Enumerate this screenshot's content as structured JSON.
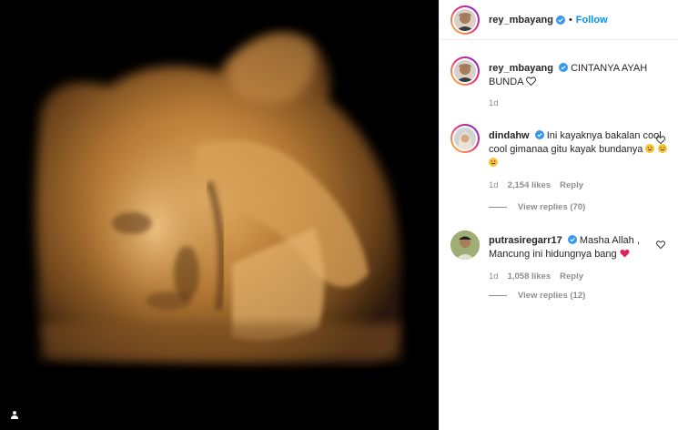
{
  "post": {
    "author": "rey_mbayang",
    "follow_label": "Follow",
    "separator": "•",
    "caption": "CINTANYA AYAH BUNDA",
    "time_ago": "1d"
  },
  "comments": [
    {
      "username": "dindahw",
      "text": "Ini kayaknya bakalan cool cool gimanaa gitu kayak bundanya",
      "emojis": [
        "grinning-face-with-sweat",
        "grinning-face-with-sweat",
        "grinning-face-with-sweat"
      ],
      "time": "1d",
      "likes": "2,154 likes",
      "reply_label": "Reply",
      "view_replies": "View replies (70)"
    },
    {
      "username": "putrasiregarr17",
      "text": "Masha Allah , Mancung ini hidungnya bang",
      "emojis": [
        "red-heart"
      ],
      "time": "1d",
      "likes": "1,058 likes",
      "reply_label": "Reply",
      "view_replies": "View replies (12)"
    }
  ],
  "colors": {
    "follow": "#0095f6",
    "verified": "#3897f0",
    "heart": "#ed4956",
    "media_bg": "#000000",
    "ultrasound_tone": "#c8903f"
  }
}
